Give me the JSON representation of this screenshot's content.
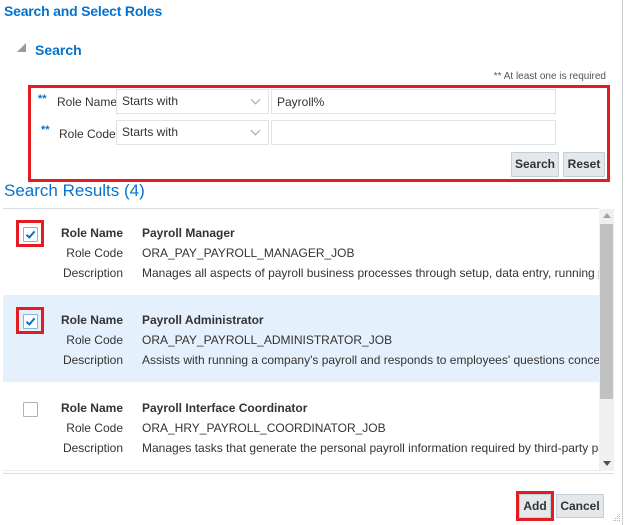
{
  "dialog": {
    "title": "Search and Select Roles"
  },
  "search": {
    "section_title": "Search",
    "required_note": "** At least one is required",
    "required_marker": "**",
    "fields": [
      {
        "label": "Role Name",
        "operator": "Starts with",
        "value": "Payroll%"
      },
      {
        "label": "Role Code",
        "operator": "Starts with",
        "value": ""
      }
    ],
    "search_button": "Search",
    "reset_button": "Reset"
  },
  "results": {
    "title": "Search Results (4)",
    "labels": {
      "role_name": "Role Name",
      "role_code": "Role Code",
      "description": "Description"
    },
    "rows": [
      {
        "checked": true,
        "role_name": "Payroll Manager",
        "role_code": "ORA_PAY_PAYROLL_MANAGER_JOB",
        "description": "Manages all aspects of payroll business processes through setup, data entry, running payroll processes"
      },
      {
        "checked": true,
        "role_name": "Payroll Administrator",
        "role_code": "ORA_PAY_PAYROLL_ADMINISTRATOR_JOB",
        "description": "Assists with running a company's payroll and responds to employees' questions concerning payroll"
      },
      {
        "checked": false,
        "role_name": "Payroll Interface Coordinator",
        "role_code": "ORA_HRY_PAYROLL_COORDINATOR_JOB",
        "description": "Manages tasks that generate the personal payroll information required by third-party payroll providers"
      }
    ]
  },
  "footer": {
    "add_button": "Add",
    "cancel_button": "Cancel"
  },
  "colors": {
    "accent": "#0572ce",
    "highlight_box": "#e31b23",
    "selected_row": "#e4f0fb",
    "button_bg": "#e4e8ea"
  }
}
